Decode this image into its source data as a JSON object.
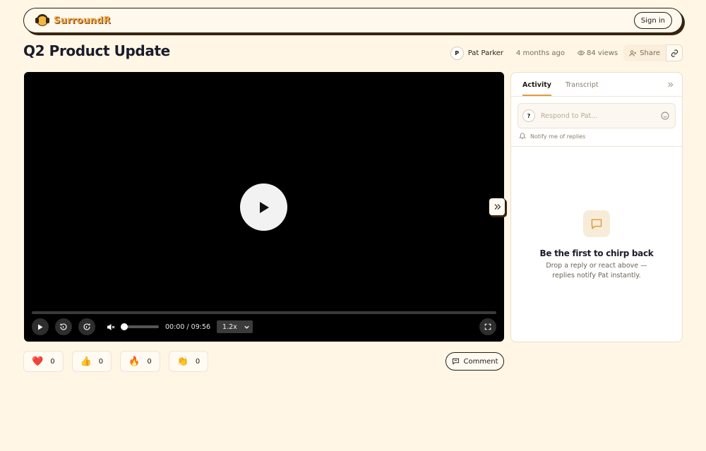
{
  "header": {
    "brand": "SurroundR",
    "signin_label": "Sign in"
  },
  "video": {
    "title": "Q2 Product Update",
    "author_initial": "P",
    "author": "Pat Parker",
    "posted": "4 months ago",
    "views": "84 views",
    "share_label": "Share"
  },
  "player": {
    "time_current": "00:00",
    "time_separator": "/",
    "time_total": "09:56",
    "speed": "1.2x",
    "progress": 0,
    "volume": 0,
    "muted": true
  },
  "reactions": [
    {
      "emoji": "❤️",
      "count": "0"
    },
    {
      "emoji": "👍",
      "count": "0"
    },
    {
      "emoji": "🔥",
      "count": "0"
    },
    {
      "emoji": "👏",
      "count": "0"
    }
  ],
  "comment_label": "Comment",
  "panel": {
    "tabs": [
      {
        "label": "Activity",
        "active": true
      },
      {
        "label": "Transcript",
        "active": false
      }
    ],
    "reply_avatar": "?",
    "reply_placeholder": "Respond to Pat...",
    "notify_label": "Notify me of replies",
    "empty_title": "Be the first to chirp back",
    "empty_text": "Drop a reply or react above — replies notify Pat instantly."
  },
  "colors": {
    "background": "#fff6e6",
    "accent": "#e49a3a",
    "brand": "#f0a441",
    "dark": "#2b1d10"
  }
}
